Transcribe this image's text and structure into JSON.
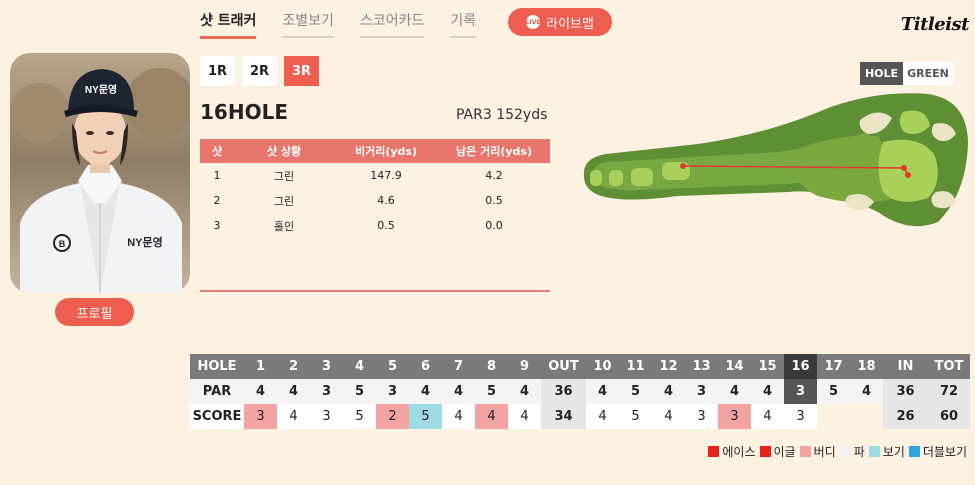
{
  "nav": {
    "tabs": [
      "샷 트래커",
      "조별보기",
      "스코어카드",
      "기록"
    ],
    "active": 0,
    "live_label": "라이브맵",
    "live_icon_text": "LIVE",
    "brand": "Titleist"
  },
  "profile": {
    "button_label": "프로필",
    "cap_text": "NY문영",
    "shirt_text": "NY문영"
  },
  "rounds": [
    "1R",
    "2R",
    "3R"
  ],
  "active_round": 2,
  "hole": {
    "title": "16HOLE",
    "par_info": "PAR3 152yds"
  },
  "shots": {
    "headers": [
      "샷",
      "샷 상황",
      "비거리(yds)",
      "남은 거리(yds)"
    ],
    "rows": [
      [
        "1",
        "그린",
        "147.9",
        "4.2"
      ],
      [
        "2",
        "그린",
        "4.6",
        "0.5"
      ],
      [
        "3",
        "홀인",
        "0.5",
        "0.0"
      ]
    ]
  },
  "map": {
    "hole_label": "HOLE",
    "green_label": "GREEN",
    "colors": {
      "rough": "#5e8f35",
      "fairway": "#9cc74e",
      "green": "#a9d15a",
      "bunker": "#e9e4c4",
      "shot_line": "#e23a2f"
    }
  },
  "scorecard": {
    "header": [
      "HOLE",
      "1",
      "2",
      "3",
      "4",
      "5",
      "6",
      "7",
      "8",
      "9",
      "OUT",
      "10",
      "11",
      "12",
      "13",
      "14",
      "15",
      "16",
      "17",
      "18",
      "IN",
      "TOT"
    ],
    "par": [
      "PAR",
      "4",
      "4",
      "3",
      "5",
      "3",
      "4",
      "4",
      "5",
      "4",
      "36",
      "4",
      "5",
      "4",
      "3",
      "4",
      "4",
      "3",
      "5",
      "4",
      "36",
      "72"
    ],
    "score": [
      "SCORE",
      "3",
      "4",
      "3",
      "5",
      "2",
      "5",
      "4",
      "4",
      "4",
      "34",
      "4",
      "5",
      "4",
      "3",
      "3",
      "4",
      "3",
      "",
      "",
      "26",
      "60"
    ],
    "current_hole": "16"
  },
  "legend": [
    {
      "label": "에이스",
      "color": "#e8231c"
    },
    {
      "label": "이글",
      "color": "#e8231c"
    },
    {
      "label": "버디",
      "color": "#f4a3a3"
    },
    {
      "label": "파",
      "color": "#f2f2f2"
    },
    {
      "label": "보기",
      "color": "#9fdbe4"
    },
    {
      "label": "더블보기",
      "color": "#2fa5e0"
    }
  ]
}
